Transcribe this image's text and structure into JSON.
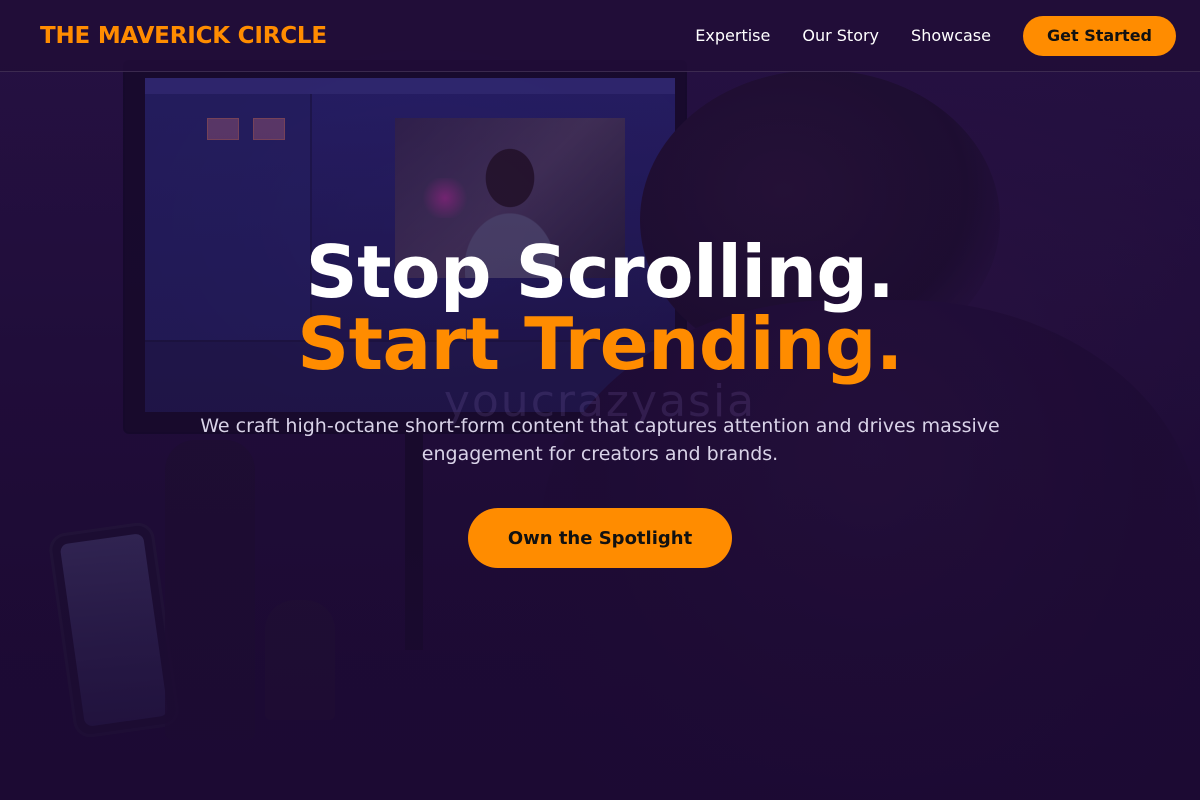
{
  "brand": {
    "name": "THE MAVERICK CIRCLE",
    "accent_color": "#ff8c00",
    "background_color": "#1c0a33"
  },
  "nav": {
    "links": [
      {
        "label": "Expertise"
      },
      {
        "label": "Our Story"
      },
      {
        "label": "Showcase"
      }
    ],
    "cta_label": "Get Started"
  },
  "hero": {
    "headline_line1": "Stop Scrolling.",
    "headline_line2": "Start Trending.",
    "subtitle": "We craft high-octane short-form content that captures attention and drives massive engagement for creators and brands.",
    "cta_label": "Own the Spotlight",
    "background_image": "video-editing-workspace",
    "watermark": "youcrazyasia"
  }
}
